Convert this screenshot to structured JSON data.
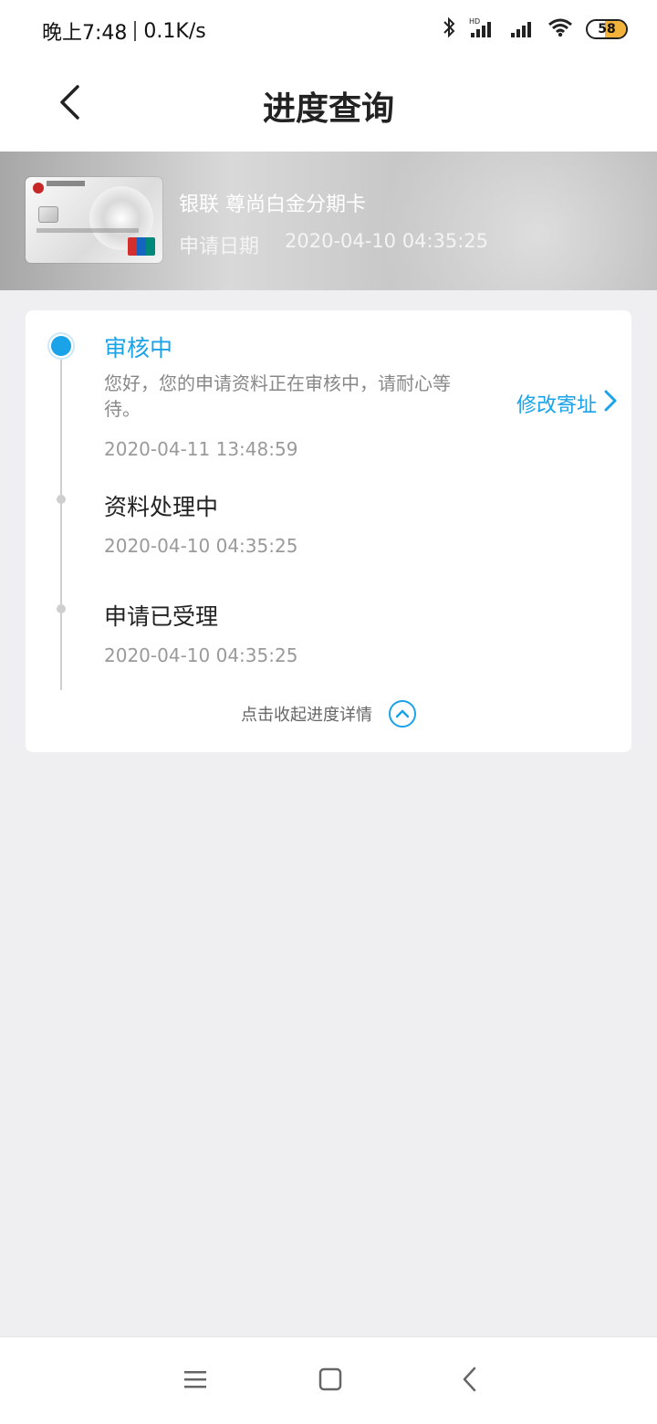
{
  "status_bar": {
    "time": "晚上7:48",
    "speed": "0.1K/s",
    "battery": "58",
    "icons": [
      "bluetooth-icon",
      "hd-signal-icon",
      "signal-icon",
      "wifi-icon",
      "battery-icon"
    ]
  },
  "nav": {
    "title": "进度查询",
    "back_icon": "chevron-left-icon"
  },
  "card": {
    "name": "银联 尊尚白金分期卡",
    "apply_label": "申请日期",
    "apply_date": "2020-04-10 04:35:25"
  },
  "progress": {
    "steps": [
      {
        "title": "审核中",
        "desc": "您好，您的申请资料正在审核中，请耐心等待。",
        "time": "2020-04-11 13:48:59",
        "active": true
      },
      {
        "title": "资料处理中",
        "time": "2020-04-10 04:35:25",
        "active": false
      },
      {
        "title": "申请已受理",
        "time": "2020-04-10 04:35:25",
        "active": false
      }
    ],
    "modify_address": "修改寄址",
    "collapse": "点击收起进度详情"
  },
  "colors": {
    "accent": "#1aa3e8",
    "background": "#efeff1",
    "muted_text": "#9a9a9a"
  }
}
